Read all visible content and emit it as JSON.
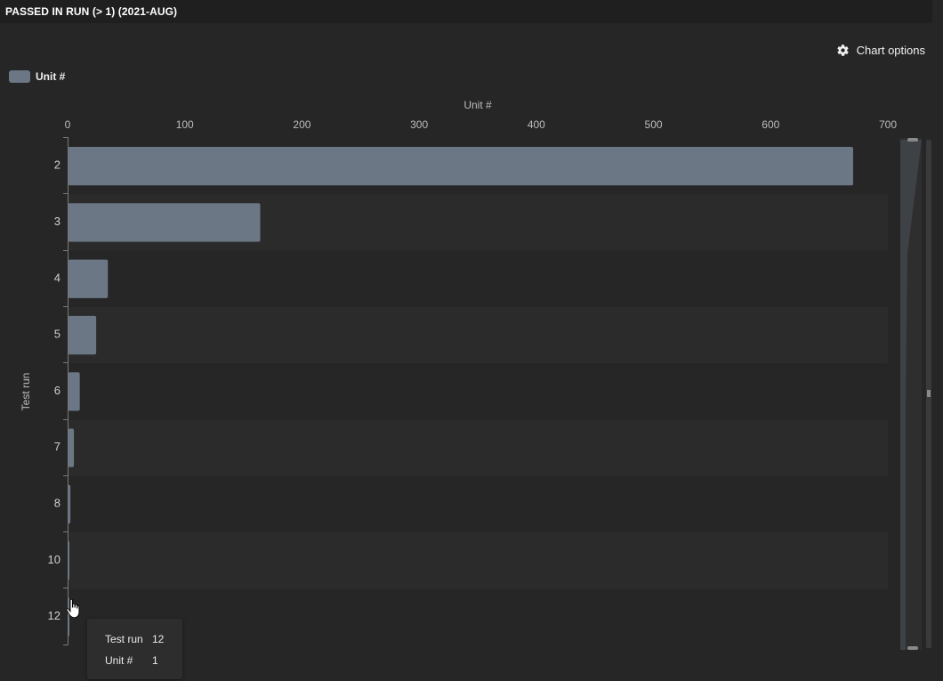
{
  "header": {
    "title": "PASSED IN RUN (> 1) (2021-AUG)"
  },
  "toolbar": {
    "chart_options_label": "Chart options",
    "chart_options_icon": "gear-icon"
  },
  "legend": {
    "items": [
      {
        "label": "Unit #",
        "color": "#6b7785"
      }
    ]
  },
  "tooltip": {
    "rows": [
      {
        "key": "Test run",
        "value": "12"
      },
      {
        "key": "Unit #",
        "value": "1"
      }
    ]
  },
  "colors": {
    "background": "#262626",
    "bar": "#6b7785",
    "band": "#2b2b2b",
    "axis": "#7a7a7a"
  },
  "chart_data": {
    "type": "bar",
    "orientation": "horizontal",
    "title": "",
    "xlabel": "Unit #",
    "ylabel": "Test run",
    "x_axis_position": "top",
    "xlim": [
      0,
      700
    ],
    "xticks": [
      0,
      100,
      200,
      300,
      400,
      500,
      600,
      700
    ],
    "categories": [
      "2",
      "3",
      "4",
      "5",
      "6",
      "7",
      "8",
      "10",
      "12"
    ],
    "series": [
      {
        "name": "Unit #",
        "values": [
          670,
          164,
          34,
          24,
          10,
          5,
          2,
          1,
          1
        ]
      }
    ],
    "grid": false,
    "legend_position": "top-left"
  }
}
